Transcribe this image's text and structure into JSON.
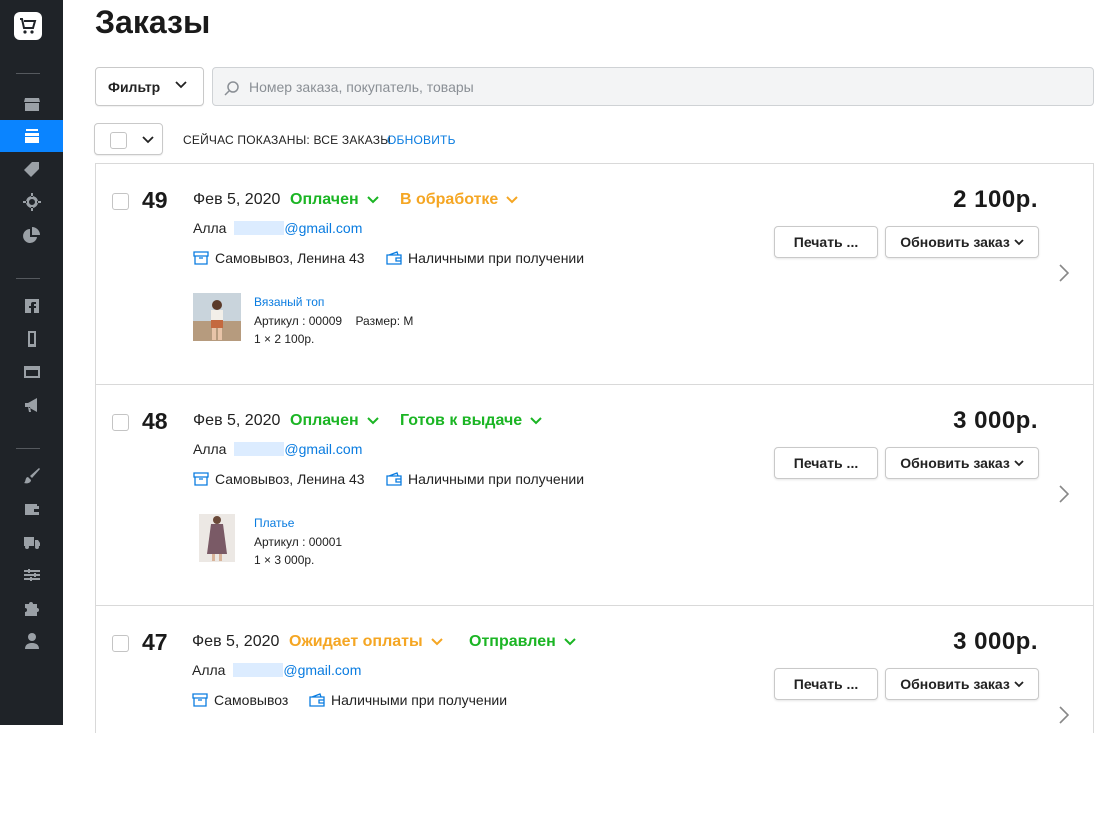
{
  "page": {
    "title": "Заказы"
  },
  "toolbar": {
    "filter_label": "Фильтр",
    "search_placeholder": "Номер заказа, покупатель, товары",
    "showing_text": "СЕЙЧАС ПОКАЗАНЫ: ВСЕ ЗАКАЗЫ",
    "refresh_label": "ОБНОВИТЬ"
  },
  "sidebar": {
    "items": [
      {
        "icon": "store-icon"
      },
      {
        "icon": "orders-icon",
        "active": true
      },
      {
        "icon": "tag-icon"
      },
      {
        "icon": "crosshair-icon"
      },
      {
        "icon": "pie-chart-icon"
      },
      {
        "icon": "facebook-icon"
      },
      {
        "icon": "mobile-icon"
      },
      {
        "icon": "browser-icon"
      },
      {
        "icon": "megaphone-icon"
      },
      {
        "icon": "brush-icon"
      },
      {
        "icon": "wallet-icon"
      },
      {
        "icon": "truck-icon"
      },
      {
        "icon": "sliders-icon"
      },
      {
        "icon": "puzzle-icon"
      },
      {
        "icon": "user-icon"
      }
    ]
  },
  "colors": {
    "accent": "#0a84ff",
    "green": "#1bb524",
    "orange": "#f5a623",
    "link": "#0a7ce0",
    "sidebar": "#1f2328"
  },
  "orders": [
    {
      "number": "49",
      "date": "Фев 5, 2020",
      "payment_status": "Оплачен",
      "fulfillment_status": "В обработке",
      "buyer": "Алла",
      "email_domain": "@gmail.com",
      "delivery": "Самовывоз, Ленина 43",
      "payment_method": "Наличными при получении",
      "total": "2 100р.",
      "print_label": "Печать ...",
      "update_label": "Обновить заказ",
      "item": {
        "name": "Вязаный топ",
        "meta": "Артикул : 00009    Размер: M",
        "qty": "1 × 2 100р."
      }
    },
    {
      "number": "48",
      "date": "Фев 5, 2020",
      "payment_status": "Оплачен",
      "fulfillment_status": "Готов к выдаче",
      "buyer": "Алла",
      "email_domain": "@gmail.com",
      "delivery": "Самовывоз, Ленина 43",
      "payment_method": "Наличными при получении",
      "total": "3 000р.",
      "print_label": "Печать ...",
      "update_label": "Обновить заказ",
      "item": {
        "name": "Платье",
        "meta": "Артикул : 00001",
        "qty": "1 × 3 000р."
      }
    },
    {
      "number": "47",
      "date": "Фев 5, 2020",
      "payment_status": "Ожидает оплаты",
      "fulfillment_status": "Отправлен",
      "buyer": "Алла",
      "email_domain": "@gmail.com",
      "delivery": "Самовывоз",
      "payment_method": "Наличными при получении",
      "total": "3 000р.",
      "print_label": "Печать ...",
      "update_label": "Обновить заказ"
    }
  ]
}
